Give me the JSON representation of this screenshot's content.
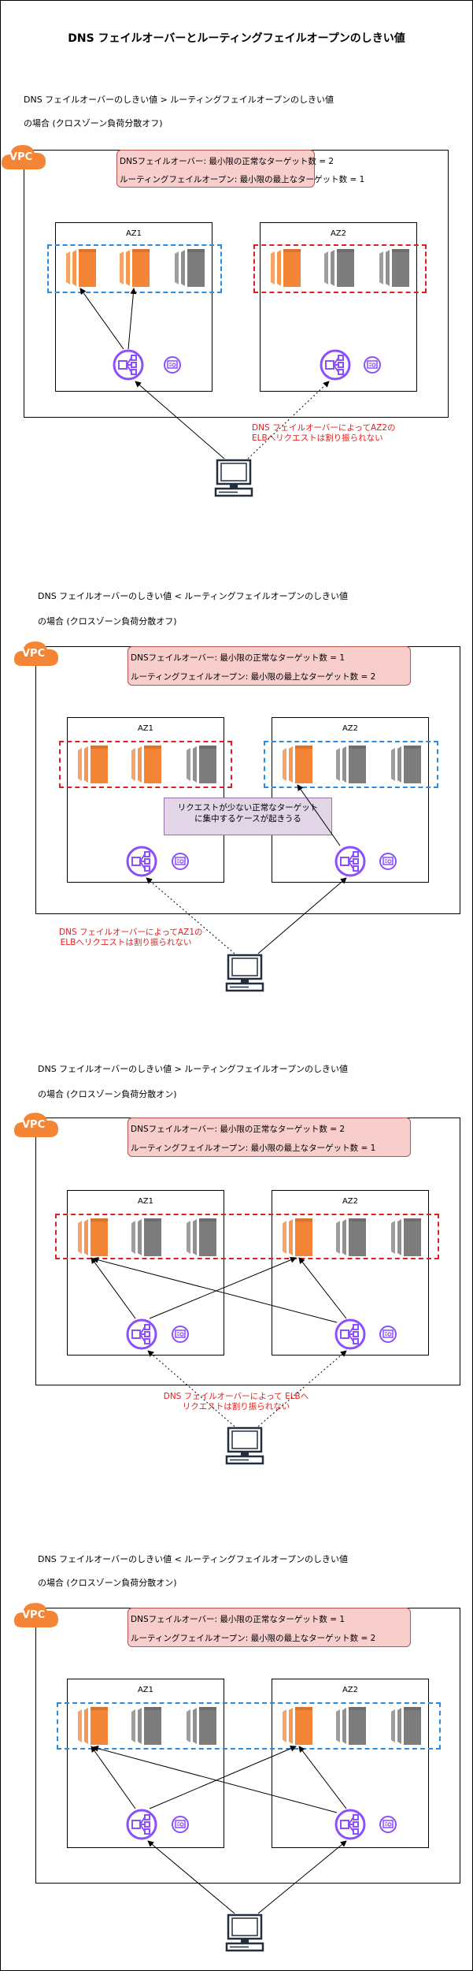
{
  "title": "DNS フェイルオーバーとルーティングフェイルオープンのしきい値",
  "labels": {
    "vpc": "VPC",
    "az1": "AZ1",
    "az2": "AZ2"
  },
  "icons": {
    "server_active": "ec2-instance-icon",
    "server_inactive": "ec2-instance-icon",
    "load_balancer": "elb-icon",
    "certificate": "certificate-icon",
    "client": "computer-icon",
    "vpc": "vpc-cloud-icon"
  },
  "colors": {
    "active": "#f58536",
    "inactive": "#7d7d7d",
    "elb": "#8c4fff",
    "red_dash": "#e01e1e",
    "blue_dash": "#2a8ce0",
    "note_fill": "#f8cecc",
    "callout_fill": "#e1d5e7",
    "vpc_badge": "#f58536"
  },
  "panels": [
    {
      "heading_line1": "DNS フェイルオーバーのしきい値 > ルーティングフェイルオープンのしきい値",
      "heading_line2": "の場合 (クロスゾーン負荷分散オフ)",
      "note_line1": "DNSフェイルオーバー: 最小限の正常なターゲット数 = 2",
      "note_line2": "ルーティングフェイルオープン: 最小限の最上なターゲット数 = 1",
      "annotation_line1": "DNS フェイルオーバーによってAZ2の",
      "annotation_line2": "ELBへリクエストは割り振られない"
    },
    {
      "heading_line1": "DNS フェイルオーバーのしきい値 < ルーティングフェイルオープンのしきい値",
      "heading_line2": "の場合 (クロスゾーン負荷分散オフ)",
      "note_line1": "DNSフェイルオーバー: 最小限の正常なターゲット数 = 1",
      "note_line2": "ルーティングフェイルオープン: 最小限の最上なターゲット数 = 2",
      "callout_line1": "リクエストが少ない正常なターゲット",
      "callout_line2": "に集中するケースが起きうる",
      "annotation_line1": "DNS フェイルオーバーによってAZ1の",
      "annotation_line2": "ELBへリクエストは割り振られない"
    },
    {
      "heading_line1": "DNS フェイルオーバーのしきい値 > ルーティングフェイルオープンのしきい値",
      "heading_line2": "の場合 (クロスゾーン負荷分散オン)",
      "note_line1": "DNSフェイルオーバー: 最小限の正常なターゲット数 = 2",
      "note_line2": "ルーティングフェイルオープン: 最小限の最上なターゲット数 = 1",
      "annotation_line1": "DNS フェイルオーバーによって ELBへ",
      "annotation_line2": "リクエストは割り振られない"
    },
    {
      "heading_line1": "DNS フェイルオーバーのしきい値 < ルーティングフェイルオープンのしきい値",
      "heading_line2": "の場合 (クロスゾーン負荷分散オン)",
      "note_line1": "DNSフェイルオーバー: 最小限の正常なターゲット数 = 1",
      "note_line2": "ルーティングフェイルオープン: 最小限の最上なターゲット数 = 2"
    }
  ]
}
